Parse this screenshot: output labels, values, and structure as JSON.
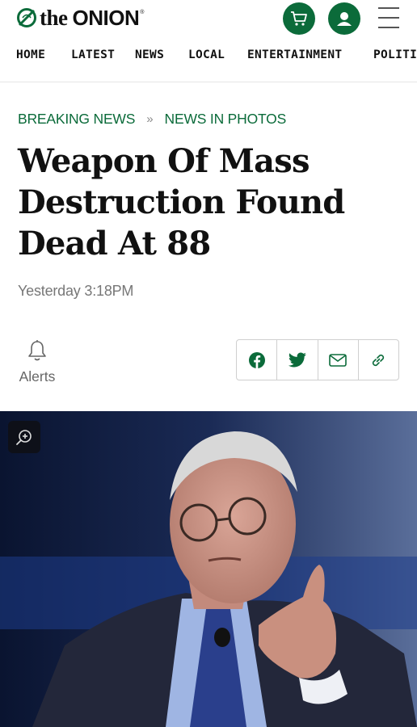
{
  "header": {
    "logo_the": "the",
    "logo_onion": "ONION",
    "logo_reg": "®",
    "icons": [
      "onion-globe-icon",
      "cart-icon",
      "user-icon",
      "hamburger-menu-icon"
    ],
    "brand_color": "#0b6b3a"
  },
  "nav": {
    "items": [
      "HOME",
      "LATEST",
      "NEWS",
      "LOCAL",
      "ENTERTAINMENT",
      "POLITI"
    ]
  },
  "breadcrumb": {
    "items": [
      "BREAKING NEWS",
      "NEWS IN PHOTOS"
    ],
    "separator": "»"
  },
  "article": {
    "title": "Weapon Of Mass Destruction Found Dead At 88",
    "timestamp": "Yesterday 3:18PM"
  },
  "alerts": {
    "label": "Alerts",
    "icon": "bell-icon"
  },
  "share": {
    "icons": [
      "facebook-icon",
      "twitter-icon",
      "email-icon",
      "link-icon"
    ]
  },
  "photo": {
    "icon": "zoom-in-icon"
  }
}
